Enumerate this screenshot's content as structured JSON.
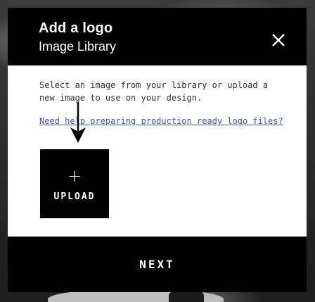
{
  "modal": {
    "title": "Add a logo",
    "subtitle": "Image Library",
    "description": "Select an image from your library or upload a new image to use on your design.",
    "help_link": "Need help preparing production ready logo files?",
    "upload": {
      "icon": "plus-icon",
      "label": "UPLOAD"
    },
    "next_label": "NEXT",
    "close_icon": "close-icon"
  },
  "colors": {
    "header_bg": "#000000",
    "link": "#3a5ba0",
    "button_bg": "#000000",
    "button_text": "#ffffff"
  }
}
